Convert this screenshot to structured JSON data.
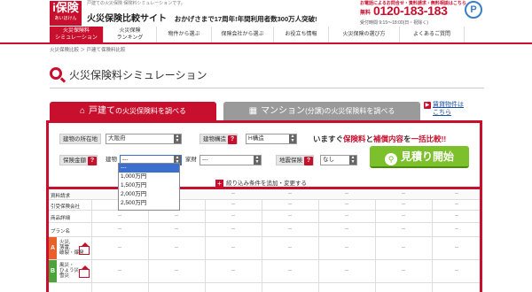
{
  "header": {
    "logo_main": "i保険",
    "logo_sub": "あいほけん",
    "tagline": "戸建ての火災保険 保険料シミュレーションです。",
    "site_title": "火災保険比較サイト",
    "site_sub_pre": "おかげさまで",
    "site_sub_highlight": "17周年!年間利用者数300万人突破!",
    "contact_top": "お電話によるお問合せ・資料請求・無料相談はこちら",
    "free_label": "無料",
    "phone": "0120-183-183",
    "hours": "受付時間 9:15～18:00(日・祝除く)",
    "mark": "P"
  },
  "nav": {
    "items": [
      {
        "label": "火災保険料\nシミュレーション",
        "active": true
      },
      {
        "label": "火災保険\nランキング",
        "active": false
      },
      {
        "label": "物件から選ぶ",
        "active": false
      },
      {
        "label": "保険会社から選ぶ",
        "active": false
      },
      {
        "label": "お役立ち情報",
        "active": false
      },
      {
        "label": "火災保険の選び方",
        "active": false
      },
      {
        "label": "よくあるご質問",
        "active": false
      }
    ]
  },
  "breadcrumb": "火災保険比較 ＞ 戸建て保険料比較",
  "page_title": "火災保険料シミュレーション",
  "tabs": {
    "house_pre": "戸建て",
    "house_post": "の火災保険料を調べる",
    "mansion_pre": "マンション",
    "mansion_mid": "(分譲)",
    "mansion_post": "の火災保険料を調べる"
  },
  "rent_link": {
    "line1": "賃貸物件は",
    "line2": "こちら"
  },
  "form": {
    "location_label": "建物の所在地",
    "location_value": "大阪府",
    "structure_label": "建物構造",
    "structure_value": "H構造",
    "promo_pre": "いますぐ",
    "promo_a": "保険料",
    "promo_mid": "と",
    "promo_b": "補償内容",
    "promo_mid2": "を",
    "promo_c": "一括比較",
    "promo_end": "!!",
    "insured_label": "保険金額",
    "building_label": "建物",
    "building_value": "---",
    "contents_label": "家財",
    "contents_value": "---",
    "earthquake_label": "地震保険",
    "earthquake_value": "なし",
    "q_mark": "?",
    "estimate_button": "見積り開始",
    "add_conditions": "絞り込み条件を追加・変更する"
  },
  "dropdown": {
    "options": [
      "---",
      "1,000万円",
      "1,500万円",
      "2,000万円",
      "2,500万円"
    ],
    "highlighted": 0
  },
  "table": {
    "rows": [
      {
        "label": "資料請求"
      },
      {
        "label": "引受保険会社"
      },
      {
        "label": "商品詳細"
      },
      {
        "label": "プラン名"
      }
    ],
    "risk_rows": [
      {
        "grade": "A",
        "label": "火災,\n落雷,\n破裂・爆発"
      },
      {
        "grade": "B",
        "label": "風災・\nひょう災,\n雪災"
      }
    ],
    "placeholder": "--"
  },
  "colors": {
    "brand_red": "#c8102e",
    "estimate_green": "#7cc02c",
    "tab_gray": "#9a9a9a"
  }
}
